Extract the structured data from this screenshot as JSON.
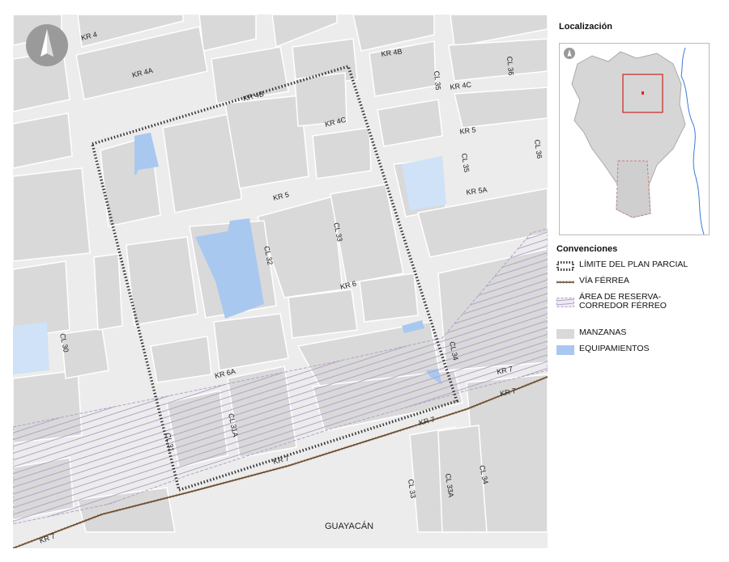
{
  "map": {
    "streets": {
      "kr4": "KR 4",
      "kr4a": "KR 4A",
      "kr4b_top": "KR 4B",
      "kr4b": "KR 4B",
      "kr4c_top": "KR 4C",
      "kr4c": "KR 4C",
      "kr5_top": "KR 5",
      "kr5": "KR 5",
      "kr5a": "KR 5A",
      "kr6": "KR 6",
      "kr6a": "KR 6A",
      "kr7_a": "KR 7",
      "kr7_b": "KR 7",
      "kr7_c": "KR 7",
      "kr7_d": "KR 7",
      "kr7_e": "KR 7",
      "cl30": "CL 30",
      "cl31": "CL 31",
      "cl31a": "CL 31A",
      "cl32": "CL 32",
      "cl33": "CL 33",
      "cl33_b": "CL 33",
      "cl33a": "CL 33A",
      "cl34": "CL 34",
      "cl34_b": "CL 34",
      "cl35_a": "CL 35",
      "cl35_b": "CL 35",
      "cl36_a": "CL 36",
      "cl36_b": "CL 36"
    },
    "place": "GUAYACÁN",
    "north_arrow": "north-arrow-icon"
  },
  "panel": {
    "locator_title": "Localización",
    "legend_title": "Convenciones",
    "legend": [
      {
        "label": "LÍMITE DEL PLAN PARCIAL",
        "symbol": "dotted-boundary"
      },
      {
        "label": "VÍA FÉRREA",
        "symbol": "railway-line"
      },
      {
        "label": "ÁREA DE RESERVA-\nCORREDOR FÉRREO",
        "symbol": "hatched-area"
      },
      {
        "label": "MANZANAS",
        "symbol": "block-fill"
      },
      {
        "label": "EQUIPAMIENTOS",
        "symbol": "equipment-fill"
      }
    ]
  },
  "colors": {
    "block": "#d9d9d9",
    "road": "#ececec",
    "equipment": "#a9c8f0",
    "equipment_light": "#cfe2f7",
    "boundary": "#333333",
    "railway": "#5a3a1a",
    "hatch": "#b3a3c6"
  }
}
